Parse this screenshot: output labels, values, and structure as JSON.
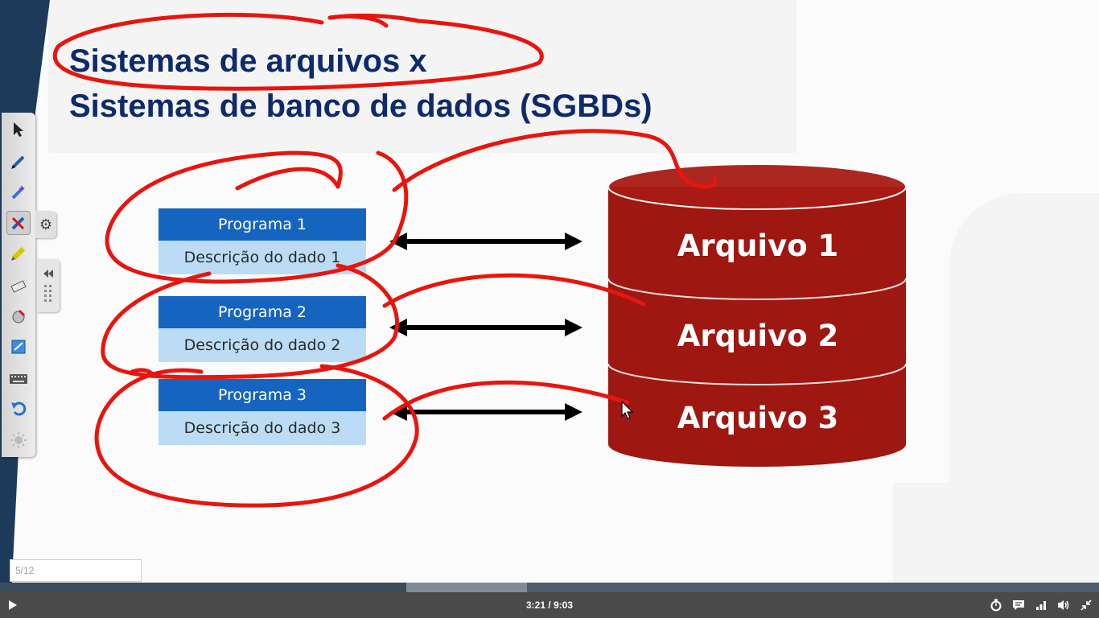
{
  "slide": {
    "title_line1": "Sistemas de arquivos x",
    "title_line2": "Sistemas de banco de dados (SGBDs)",
    "programs": [
      {
        "name": "Programa 1",
        "description": "Descrição do dado 1"
      },
      {
        "name": "Programa 2",
        "description": "Descrição do dado 2"
      },
      {
        "name": "Programa 3",
        "description": "Descrição do dado 3"
      }
    ],
    "files": [
      "Arquivo 1",
      "Arquivo 2",
      "Arquivo 3"
    ]
  },
  "toolbar": {
    "tools": [
      "select-arrow-icon",
      "pen-icon",
      "magic-pen-icon",
      "eraser-pen-icon",
      "highlighter-icon",
      "eraser-icon",
      "fill-icon",
      "screen-capture-icon",
      "keyboard-icon",
      "undo-icon",
      "spotlight-icon"
    ],
    "active_tool": "eraser-pen-icon"
  },
  "page_indicator": "5/12",
  "player": {
    "time": "3:21 / 9:03",
    "progress_fraction": 0.37,
    "buffered_fraction": 0.48
  },
  "colors": {
    "title": "#0d2a6b",
    "program_header": "#1565c0",
    "program_body": "#bcdcf5",
    "database": "#9e1711",
    "annotation": "#e8150f",
    "control_bar": "#4a4a4a"
  }
}
